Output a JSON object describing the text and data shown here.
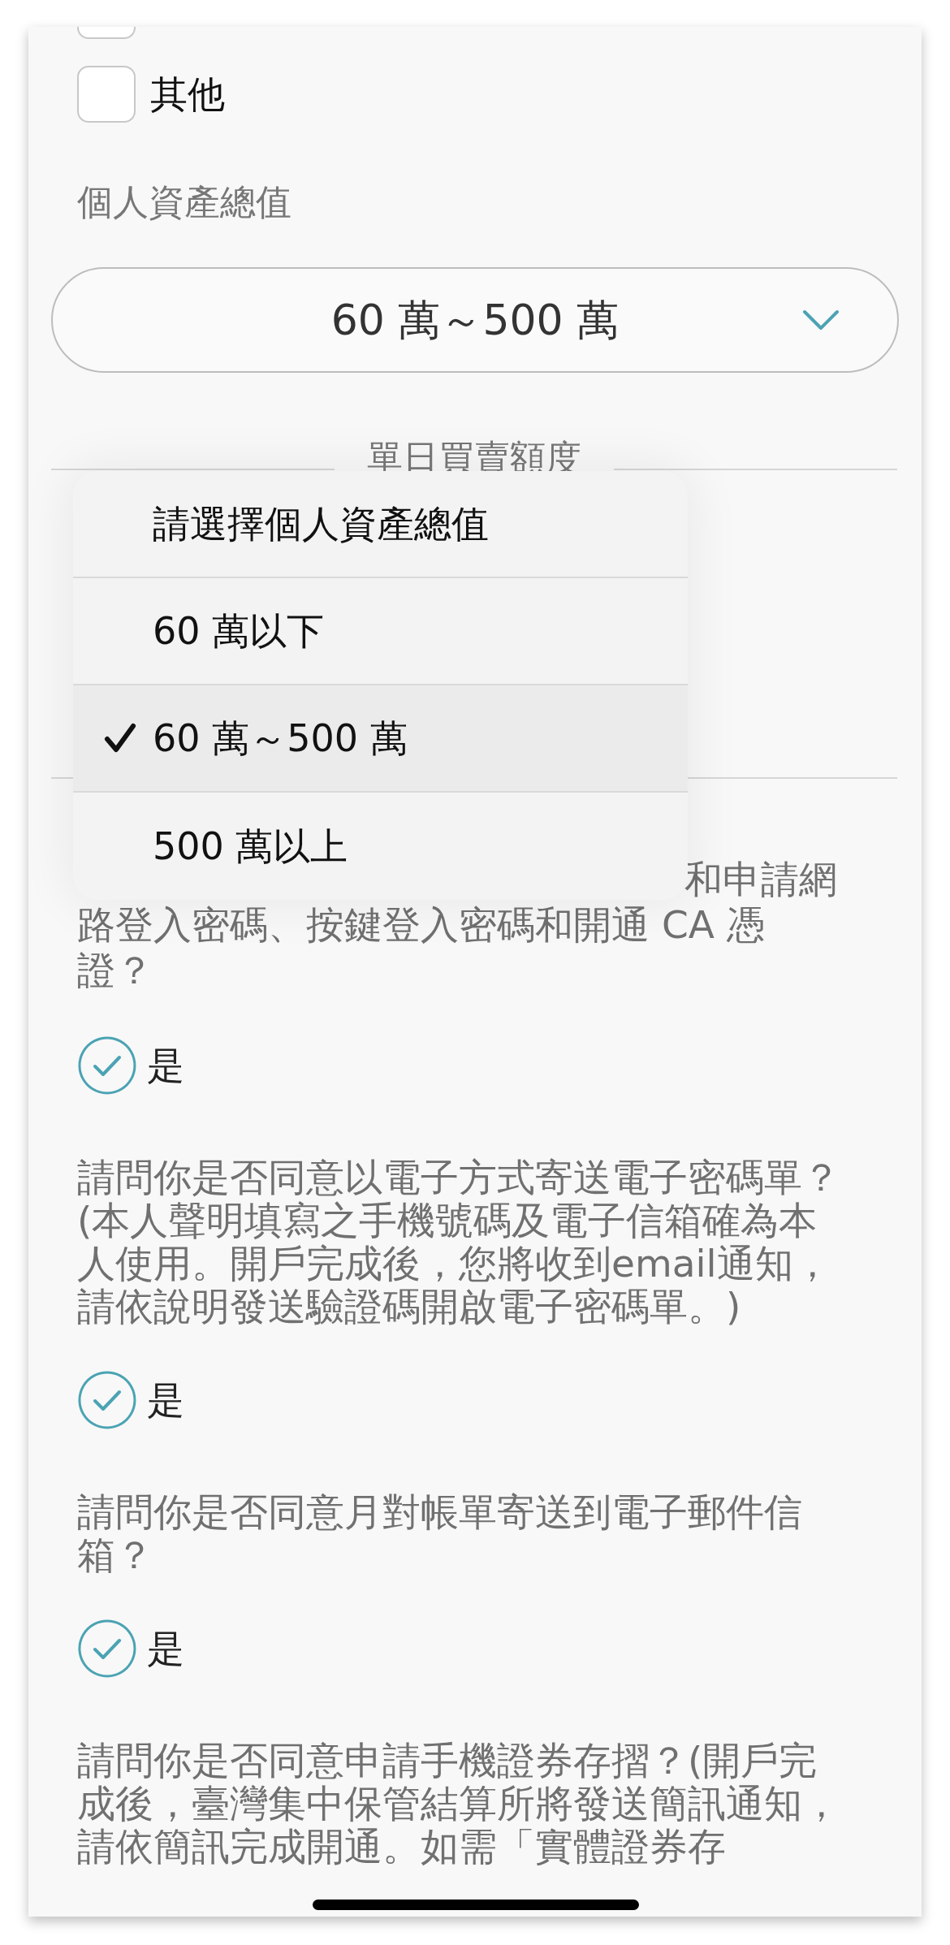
{
  "checkbox_options": [
    {
      "checked": false
    },
    {
      "label": "其他",
      "checked": false
    }
  ],
  "asset_field": {
    "label": "個人資產總值",
    "value": "60 萬～500 萬"
  },
  "section_heading": "單日買賣額度",
  "dropdown_menu": {
    "options": [
      {
        "label": "請選擇個人資產總值",
        "selected": false
      },
      {
        "label": "60 萬以下",
        "selected": false
      },
      {
        "label": "60 萬～500 萬",
        "selected": true
      },
      {
        "label": "500 萬以上",
        "selected": false
      }
    ]
  },
  "questions": [
    {
      "kind": "partly_covered",
      "text": "和申請網路登入密碼、按鍵登入密碼和開通 CA 憑證？",
      "answer": "是",
      "checked": true
    },
    {
      "kind": "full",
      "text": "請問你是否同意以電子方式寄送電子密碼單？(本人聲明填寫之手機號碼及電子信箱確為本人使用。開戶完成後，您將收到email通知，請依說明發送驗證碼開啟電子密碼單。)",
      "answer": "是",
      "checked": true
    },
    {
      "kind": "full",
      "text": "請問你是否同意月對帳單寄送到電子郵件信箱？",
      "answer": "是",
      "checked": true
    },
    {
      "kind": "full",
      "text": "請問你是否同意申請手機證券存摺？(開戶完成後，臺灣集中保管結算所將發送簡訊通知，請依簡訊完成開通。如需「實體證券存"
    }
  ]
}
